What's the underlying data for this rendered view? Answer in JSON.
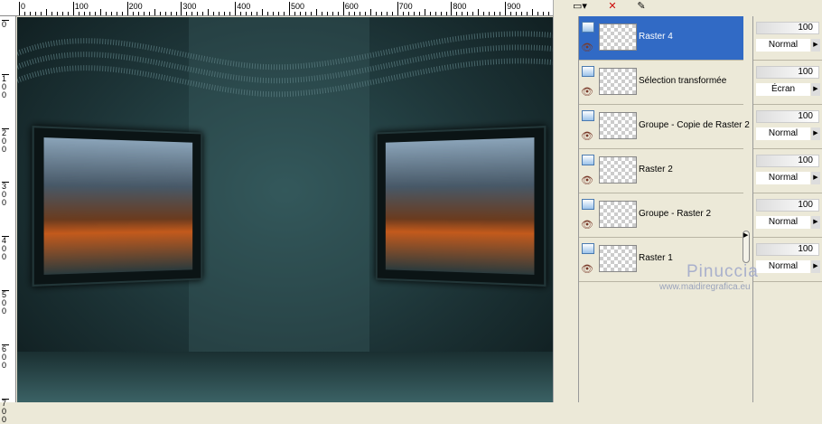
{
  "rulers": {
    "horizontal": [
      "0",
      "100",
      "200",
      "300",
      "400",
      "500",
      "600",
      "700",
      "800",
      "900"
    ],
    "vertical": [
      "0",
      "100",
      "200",
      "300",
      "400",
      "500",
      "600",
      "700"
    ]
  },
  "layers": [
    {
      "name": "Raster 4",
      "opacity": "100",
      "blend": "Normal",
      "selected": true
    },
    {
      "name": "Sélection transformée",
      "opacity": "100",
      "blend": "Écran"
    },
    {
      "name": "Groupe - Copie de Raster 2",
      "opacity": "100",
      "blend": "Normal"
    },
    {
      "name": "Raster 2",
      "opacity": "100",
      "blend": "Normal"
    },
    {
      "name": "Groupe - Raster 2",
      "opacity": "100",
      "blend": "Normal"
    },
    {
      "name": "Raster 1",
      "opacity": "100",
      "blend": "Normal"
    }
  ],
  "watermark": {
    "name": "Pinuccia",
    "url": "www.maidiregrafica.eu"
  },
  "colors": {
    "selection": "#316ac5",
    "panel": "#ece9d8"
  }
}
